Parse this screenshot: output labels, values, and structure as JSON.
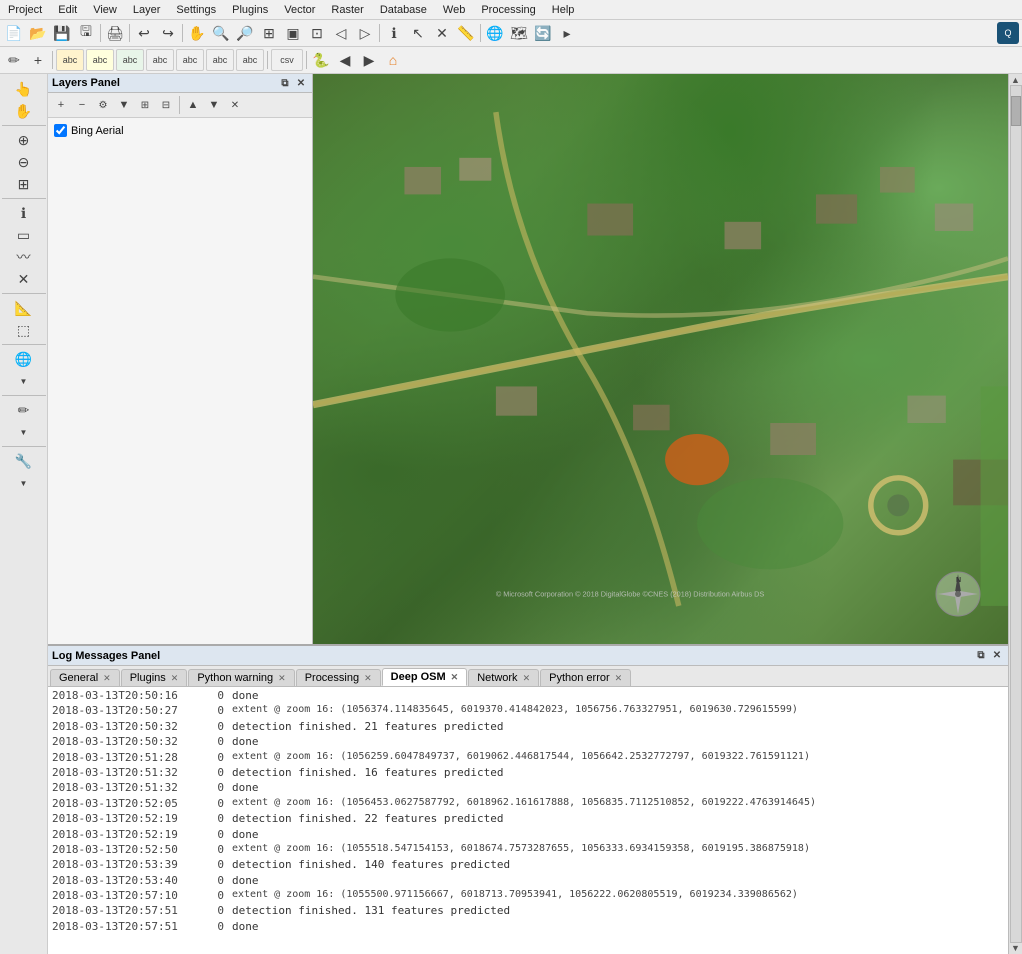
{
  "app": {
    "title": "QGIS"
  },
  "menubar": {
    "items": [
      "Project",
      "Edit",
      "View",
      "Layer",
      "Settings",
      "Plugins",
      "Vector",
      "Raster",
      "Database",
      "Web",
      "Processing",
      "Help"
    ]
  },
  "toolbar1": {
    "buttons": [
      "new",
      "open",
      "save",
      "save-as",
      "print",
      "undo",
      "redo",
      "pan",
      "zoom-in",
      "zoom-out",
      "identify",
      "select",
      "deselect",
      "measure",
      "add-wms",
      "add-wfs",
      "add-osm",
      "digitize",
      "node",
      "split",
      "merge",
      "rotate",
      "offset"
    ]
  },
  "toolbar2": {
    "buttons": [
      "label1",
      "label2",
      "label3",
      "label4",
      "label5",
      "label6",
      "label7",
      "csv",
      "python",
      "refresh"
    ]
  },
  "layers_panel": {
    "title": "Layers Panel",
    "layers": [
      {
        "id": "bing",
        "label": "Bing Aerial",
        "checked": true
      }
    ]
  },
  "log_panel": {
    "title": "Log Messages Panel",
    "tabs": [
      {
        "id": "general",
        "label": "General",
        "closable": true,
        "active": false
      },
      {
        "id": "plugins",
        "label": "Plugins",
        "closable": true,
        "active": false
      },
      {
        "id": "python-warning",
        "label": "Python warning",
        "closable": true,
        "active": false
      },
      {
        "id": "processing",
        "label": "Processing",
        "closable": true,
        "active": false
      },
      {
        "id": "deep-osm",
        "label": "Deep OSM",
        "closable": true,
        "active": true
      },
      {
        "id": "network",
        "label": "Network",
        "closable": true,
        "active": false
      },
      {
        "id": "python-error",
        "label": "Python error",
        "closable": true,
        "active": false
      }
    ],
    "log_entries": [
      {
        "timestamp": "2018-03-13T20:50:16",
        "num": "0",
        "message": "done",
        "type": "done"
      },
      {
        "timestamp": "2018-03-13T20:50:27",
        "num": "0",
        "message": "extent @ zoom 16: (1056374.114835645, 6019370.414842023, 1056756.763327951, 6019630.729615599)",
        "type": "extent"
      },
      {
        "timestamp": "2018-03-13T20:50:32",
        "num": "0",
        "message": "detection finished. 21 features predicted",
        "type": "detect"
      },
      {
        "timestamp": "2018-03-13T20:50:32",
        "num": "0",
        "message": "done",
        "type": "done"
      },
      {
        "timestamp": "2018-03-13T20:51:28",
        "num": "0",
        "message": "extent @ zoom 16: (1056259.6047849737, 6019062.446817544, 1056642.2532772797, 6019322.761591121)",
        "type": "extent"
      },
      {
        "timestamp": "2018-03-13T20:51:32",
        "num": "0",
        "message": "detection finished. 16 features predicted",
        "type": "detect"
      },
      {
        "timestamp": "2018-03-13T20:51:32",
        "num": "0",
        "message": "done",
        "type": "done"
      },
      {
        "timestamp": "2018-03-13T20:52:05",
        "num": "0",
        "message": "extent @ zoom 16: (1056453.0627587792, 6018962.161617888, 1056835.7112510852, 6019222.4763914645)",
        "type": "extent"
      },
      {
        "timestamp": "2018-03-13T20:52:19",
        "num": "0",
        "message": "detection finished. 22 features predicted",
        "type": "detect"
      },
      {
        "timestamp": "2018-03-13T20:52:19",
        "num": "0",
        "message": "done",
        "type": "done"
      },
      {
        "timestamp": "2018-03-13T20:52:50",
        "num": "0",
        "message": "extent @ zoom 16: (1055518.547154153, 6018674.7573287655, 1056333.6934159358, 6019195.386875918)",
        "type": "extent"
      },
      {
        "timestamp": "2018-03-13T20:53:39",
        "num": "0",
        "message": "detection finished. 140 features predicted",
        "type": "detect"
      },
      {
        "timestamp": "2018-03-13T20:53:40",
        "num": "0",
        "message": "done",
        "type": "done"
      },
      {
        "timestamp": "2018-03-13T20:57:10",
        "num": "0",
        "message": "extent @ zoom 16: (1055500.971156667, 6018713.70953941, 1056222.0620805519, 6019234.339086562)",
        "type": "extent"
      },
      {
        "timestamp": "2018-03-13T20:57:51",
        "num": "0",
        "message": "detection finished. 131 features predicted",
        "type": "detect"
      },
      {
        "timestamp": "2018-03-13T20:57:51",
        "num": "0",
        "message": "done",
        "type": "done"
      }
    ]
  },
  "statusbar": {
    "coords": "",
    "scale": "",
    "epsg": ""
  }
}
